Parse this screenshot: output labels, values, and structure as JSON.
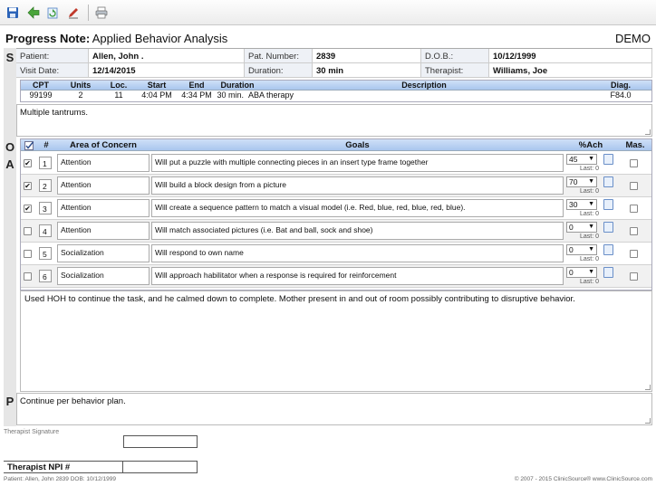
{
  "toolbar": {
    "icons": [
      "save-icon",
      "back-icon",
      "refresh-icon",
      "edit-icon",
      "print-icon"
    ]
  },
  "title": {
    "bold": "Progress Note:",
    "rest": "Applied Behavior Analysis",
    "demo": "DEMO"
  },
  "sections": {
    "s": "S",
    "o": "O",
    "a": "A",
    "p": "P"
  },
  "patient_info": {
    "patient_label": "Patient:",
    "patient_value": "Allen, John .",
    "pat_number_label": "Pat. Number:",
    "pat_number_value": "2839",
    "dob_label": "D.O.B.:",
    "dob_value": "10/12/1999",
    "visit_date_label": "Visit Date:",
    "visit_date_value": "12/14/2015",
    "duration_label": "Duration:",
    "duration_value": "30 min",
    "therapist_label": "Therapist:",
    "therapist_value": "Williams, Joe"
  },
  "cpt_table": {
    "headers": [
      "CPT",
      "Units",
      "Loc.",
      "Start",
      "End",
      "Duration",
      "Description",
      "Diag."
    ],
    "row": {
      "cpt": "99199",
      "units": "2",
      "loc": "11",
      "start": "4:04 PM",
      "end": "4:34 PM",
      "duration": "30 min.",
      "description": "ABA therapy",
      "diag": "F84.0"
    }
  },
  "subjective_text": "Multiple tantrums.",
  "goals_table": {
    "headers": {
      "check": "✓",
      "num": "#",
      "area": "Area of Concern",
      "goals": "Goals",
      "ach": "%Ach",
      "mas": "Mas."
    },
    "rows": [
      {
        "checked": true,
        "num": "1",
        "area": "Attention",
        "goal": "Will put a puzzle with multiple connecting pieces in an insert type frame together",
        "ach": "45",
        "last": "Last: 0"
      },
      {
        "checked": true,
        "num": "2",
        "area": "Attention",
        "goal": "Will build a block design from a picture",
        "ach": "70",
        "last": "Last: 0"
      },
      {
        "checked": true,
        "num": "3",
        "area": "Attention",
        "goal": "Will create a sequence pattern to match a visual model (i.e. Red, blue, red, blue, red, blue).",
        "ach": "30",
        "last": "Last: 0"
      },
      {
        "checked": false,
        "num": "4",
        "area": "Attention",
        "goal": "Will match associated pictures (i.e. Bat and ball, sock and shoe)",
        "ach": "0",
        "last": "Last: 0"
      },
      {
        "checked": false,
        "num": "5",
        "area": "Socialization",
        "goal": "Will respond to own name",
        "ach": "0",
        "last": "Last: 0"
      },
      {
        "checked": false,
        "num": "6",
        "area": "Socialization",
        "goal": "Will approach habilitator when a response is required for reinforcement",
        "ach": "0",
        "last": "Last: 0"
      }
    ]
  },
  "observation_text": "Used HOH to continue the task, and he calmed down to complete.  Mother present in and out of room possibly contributing to disruptive behavior.",
  "plan_text": "Continue per behavior plan.",
  "signature_label": "Therapist Signature",
  "npi_label": "Therapist NPI #",
  "footer": {
    "left": "Patient: Allen, John  2839 DOB: 10/12/1999",
    "right": "© 2007 - 2015 ClinicSource®   www.ClinicSource.com"
  },
  "colors": {
    "header_blue": "#a9c6ee",
    "sidebar_gray": "#e6e6e6"
  }
}
